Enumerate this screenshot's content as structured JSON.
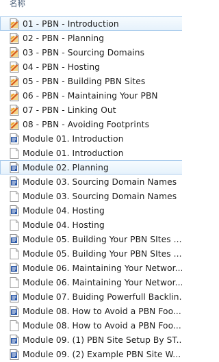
{
  "header": {
    "column_name": "名称"
  },
  "files": [
    {
      "name": "01 - PBN - Introduction",
      "icon": "video-file-icon",
      "selected": true
    },
    {
      "name": "02 - PBN - Planning",
      "icon": "video-file-icon",
      "selected": false
    },
    {
      "name": "03 - PBN - Sourcing Domains",
      "icon": "video-file-icon",
      "selected": false
    },
    {
      "name": "04 - PBN - Hosting",
      "icon": "video-file-icon",
      "selected": false
    },
    {
      "name": "05 - PBN - Building PBN Sites",
      "icon": "video-file-icon",
      "selected": false
    },
    {
      "name": "06 - PBN - Maintaining Your PBN",
      "icon": "video-file-icon",
      "selected": false
    },
    {
      "name": "07 - PBN - Linking Out",
      "icon": "video-file-icon",
      "selected": false
    },
    {
      "name": "08 - PBN - Avoiding Footprints",
      "icon": "video-file-icon",
      "selected": false
    },
    {
      "name": "Module 01. Introduction",
      "icon": "document-file-icon",
      "selected": false
    },
    {
      "name": "Module 01. Introduction",
      "icon": "text-file-icon",
      "selected": false
    },
    {
      "name": "Module 02. Planning",
      "icon": "document-file-icon",
      "selected": true
    },
    {
      "name": "Module 03. Sourcing Domain Names",
      "icon": "document-file-icon",
      "selected": false
    },
    {
      "name": "Module 03. Sourcing Domain Names",
      "icon": "text-file-icon",
      "selected": false
    },
    {
      "name": "Module 04. Hosting",
      "icon": "document-file-icon",
      "selected": false
    },
    {
      "name": "Module 04. Hosting",
      "icon": "text-file-icon",
      "selected": false
    },
    {
      "name": "Module 05. Building Your PBN SItes ...",
      "icon": "document-file-icon",
      "selected": false
    },
    {
      "name": "Module 05. Building Your PBN SItes ...",
      "icon": "text-file-icon",
      "selected": false
    },
    {
      "name": "Module 06. Maintaining Your Networ...",
      "icon": "document-file-icon",
      "selected": false
    },
    {
      "name": "Module 06. Maintaining Your Networ...",
      "icon": "text-file-icon",
      "selected": false
    },
    {
      "name": "Module 07. Buiding Powerfull Backlin...",
      "icon": "document-file-icon",
      "selected": false
    },
    {
      "name": "Module 08. How to Avoid a PBN Foo...",
      "icon": "document-file-icon",
      "selected": false
    },
    {
      "name": "Module 08. How to Avoid a PBN Foo...",
      "icon": "text-file-icon",
      "selected": false
    },
    {
      "name": "Module 09.  (1) PBN Site Setup By ST...",
      "icon": "document-file-icon",
      "selected": false
    },
    {
      "name": "Module 09.  (2) Example PBN Site W...",
      "icon": "document-file-icon",
      "selected": false
    }
  ]
}
